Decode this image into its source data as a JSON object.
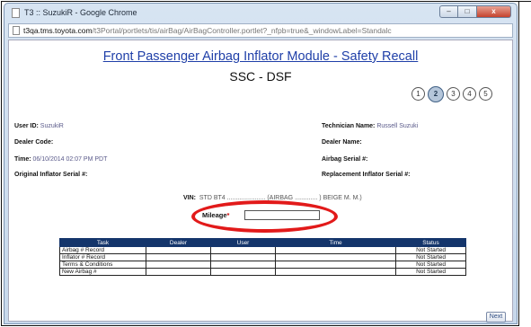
{
  "window": {
    "title": "T3 :: SuzukiR - Google Chrome",
    "min_label": "–",
    "max_label": "□",
    "close_label": "x"
  },
  "address": {
    "host": "t3qa.tms.toyota.com",
    "path": "/t3Portal/portlets/tis/airBag/AirBagController.portlet?_nfpb=true&_windowLabel=Standalc"
  },
  "page": {
    "title": "Front Passenger Airbag Inflator Module - Safety Recall",
    "subtitle": "SSC - DSF"
  },
  "steps": [
    "1",
    "2",
    "3",
    "4",
    "5"
  ],
  "left_fields": [
    {
      "label": "User ID:",
      "value": " SuzukiR"
    },
    {
      "label": "Dealer Code:",
      "value": ""
    },
    {
      "label": "Time:",
      "value": " 06/10/2014 02:07 PM PDT"
    },
    {
      "label": "Original Inflator Serial #:",
      "value": ""
    }
  ],
  "right_fields": [
    {
      "label": "Technician Name:",
      "value": " Russell Suzuki"
    },
    {
      "label": "Dealer Name:",
      "value": ""
    },
    {
      "label": "Airbag Serial #:",
      "value": ""
    },
    {
      "label": "Replacement Inflator Serial #:",
      "value": ""
    }
  ],
  "vin": {
    "label": "VIN:",
    "value": "STD BT4 ...................... (AIRBAG ............. ) BEIGE M. M.)"
  },
  "mileage": {
    "label": "Mileage",
    "required_mark": "*",
    "value": ""
  },
  "table": {
    "headers": [
      "Task",
      "Dealer",
      "User",
      "Time",
      "Status"
    ],
    "rows": [
      [
        "Airbag # Record",
        "",
        "",
        "",
        "Not Started"
      ],
      [
        "Inflator # Record",
        "",
        "",
        "",
        "Not Started"
      ],
      [
        "Terms & Conditions",
        "",
        "",
        "",
        "Not Started"
      ],
      [
        "New Airbag #",
        "",
        "",
        "",
        "Not Started"
      ]
    ]
  },
  "next_label": "Next"
}
